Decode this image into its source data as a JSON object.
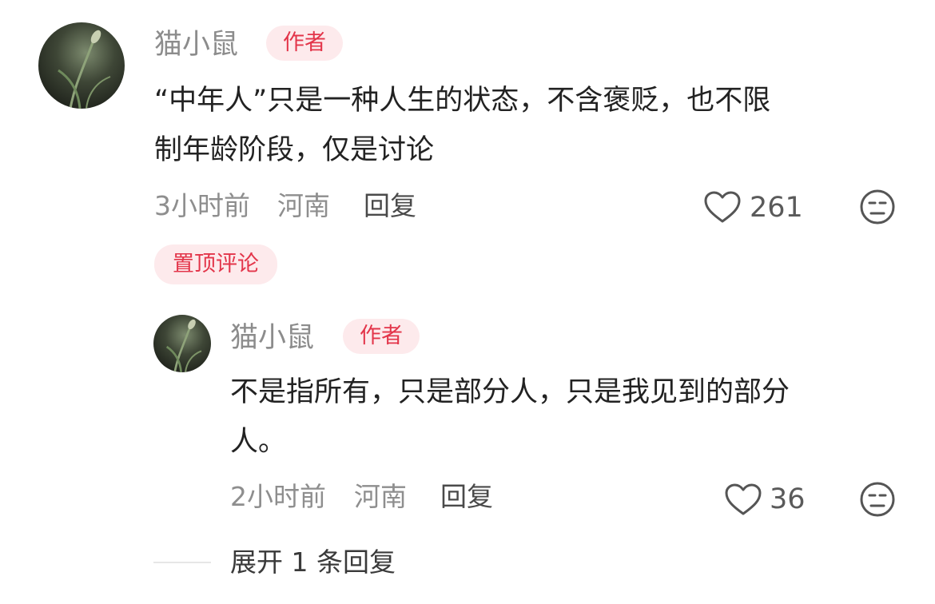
{
  "comments": [
    {
      "user": {
        "name": "猫小鼠",
        "badge": "作者"
      },
      "text_lines": [
        "“中年人”只是一种人生的状态，不含褒贬，也不限",
        "制年龄阶段，仅是讨论"
      ],
      "time": "3小时前",
      "location": "河南",
      "reply_label": "回复",
      "likes": "261",
      "like_icon": "heart-icon",
      "dislike_icon": "unhappy-face-icon",
      "pinned_label": "置顶评论",
      "reply_thread": {
        "user": {
          "name": "猫小鼠",
          "badge": "作者"
        },
        "text_lines": [
          "不是指所有，只是部分人，只是我见到的部分",
          "人。"
        ],
        "time": "2小时前",
        "location": "河南",
        "reply_label": "回复",
        "likes": "36"
      },
      "expand_label": "展开 1 条回复"
    }
  ],
  "colors": {
    "badge_bg": "#fdeaec",
    "badge_text": "#e3354a",
    "meta_gray": "#8e8e8e"
  }
}
